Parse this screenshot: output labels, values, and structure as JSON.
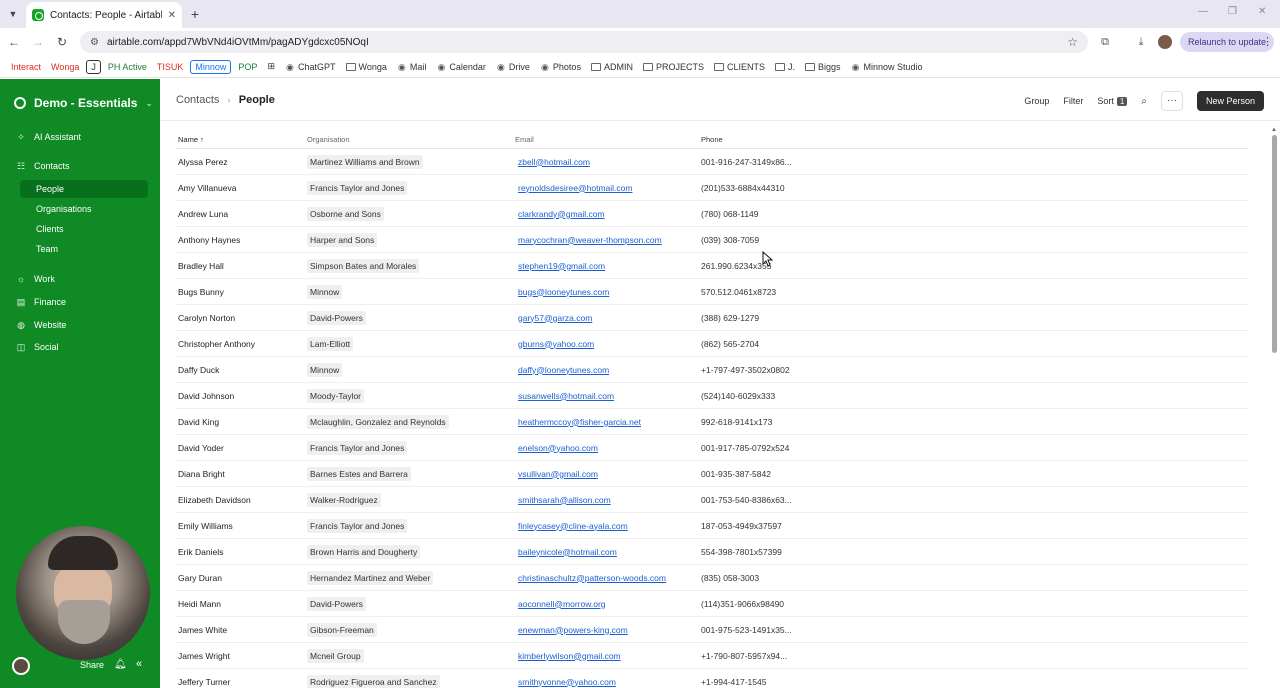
{
  "browser": {
    "tab_title": "Contacts: People - Airtable",
    "url": "airtable.com/appd7WbVNd4iOVtMm/pagADYgdcxc05NOqI",
    "relaunch_label": "Relaunch to update"
  },
  "bookmarks": [
    {
      "label": "Interact",
      "color": "#d93025",
      "style": "text"
    },
    {
      "label": "Wonga",
      "color": "#d93025",
      "style": "text"
    },
    {
      "label": "J",
      "color": "#333333",
      "style": "box"
    },
    {
      "label": "PH Active",
      "color": "#1e7e34",
      "style": "text"
    },
    {
      "label": "TISUK",
      "color": "#d93025",
      "style": "text"
    },
    {
      "label": "Minnow",
      "color": "#1a73e8",
      "style": "box"
    },
    {
      "label": "POP",
      "color": "#188038",
      "style": "text"
    },
    {
      "label": "ChatGPT",
      "color": "#333333",
      "style": "icon"
    },
    {
      "label": "Wonga",
      "color": "#333333",
      "style": "folder"
    },
    {
      "label": "Mail",
      "color": "#333333",
      "style": "icon"
    },
    {
      "label": "Calendar",
      "color": "#333333",
      "style": "icon"
    },
    {
      "label": "Drive",
      "color": "#333333",
      "style": "icon"
    },
    {
      "label": "Photos",
      "color": "#333333",
      "style": "icon"
    },
    {
      "label": "ADMIN",
      "color": "#333333",
      "style": "folder"
    },
    {
      "label": "PROJECTS",
      "color": "#333333",
      "style": "folder"
    },
    {
      "label": "CLIENTS",
      "color": "#333333",
      "style": "folder"
    },
    {
      "label": "J.",
      "color": "#333333",
      "style": "folder"
    },
    {
      "label": "Biggs",
      "color": "#333333",
      "style": "folder"
    },
    {
      "label": "Minnow Studio",
      "color": "#333333",
      "style": "icon"
    }
  ],
  "sidebar": {
    "workspace": "Demo - Essentials",
    "ai_assistant": "AI Assistant",
    "contacts": "Contacts",
    "contacts_sub": [
      "People",
      "Organisations",
      "Clients",
      "Team"
    ],
    "work": "Work",
    "finance": "Finance",
    "website": "Website",
    "social": "Social",
    "share": "Share"
  },
  "main": {
    "breadcrumb_parent": "Contacts",
    "breadcrumb_current": "People",
    "group": "Group",
    "filter": "Filter",
    "sort": "Sort",
    "sort_count": "1",
    "new_button": "New Person"
  },
  "table": {
    "headers": {
      "name": "Name",
      "organisation": "Organisation",
      "email": "Email",
      "phone": "Phone"
    },
    "rows": [
      {
        "name": "Alyssa Perez",
        "org": "Martinez Williams and Brown",
        "email": "zbell@hotmail.com",
        "phone": "001-916-247-3149x86..."
      },
      {
        "name": "Amy Villanueva",
        "org": "Francis Taylor and Jones",
        "email": "reynoldsdesiree@hotmail.com",
        "phone": "(201)533-6884x44310"
      },
      {
        "name": "Andrew Luna",
        "org": "Osborne and Sons",
        "email": "clarkrandy@gmail.com",
        "phone": "(780) 068-1149"
      },
      {
        "name": "Anthony Haynes",
        "org": "Harper and Sons",
        "email": "marycochran@weaver-thompson.com",
        "phone": "(039) 308-7059"
      },
      {
        "name": "Bradley Hall",
        "org": "Simpson Bates and Morales",
        "email": "stephen19@gmail.com",
        "phone": "261.990.6234x355"
      },
      {
        "name": "Bugs Bunny",
        "org": "Minnow",
        "email": "bugs@looneytunes.com",
        "phone": "570.512.0461x8723"
      },
      {
        "name": "Carolyn Norton",
        "org": "David-Powers",
        "email": "gary57@garza.com",
        "phone": "(388) 629-1279"
      },
      {
        "name": "Christopher Anthony",
        "org": "Lam-Elliott",
        "email": "gburns@yahoo.com",
        "phone": "(862) 565-2704"
      },
      {
        "name": "Daffy Duck",
        "org": "Minnow",
        "email": "daffy@looneytunes.com",
        "phone": "+1-797-497-3502x0802"
      },
      {
        "name": "David Johnson",
        "org": "Moody-Taylor",
        "email": "susanwells@hotmail.com",
        "phone": "(524)140-6029x333"
      },
      {
        "name": "David King",
        "org": "Mclaughlin, Gonzalez and Reynolds",
        "email": "heathermccoy@fisher-garcia.net",
        "phone": "992-618-9141x173"
      },
      {
        "name": "David Yoder",
        "org": "Francis Taylor and Jones",
        "email": "enelson@yahoo.com",
        "phone": "001-917-785-0792x524"
      },
      {
        "name": "Diana Bright",
        "org": "Barnes Estes and Barrera",
        "email": "vsullivan@gmail.com",
        "phone": "001-935-387-5842"
      },
      {
        "name": "Elizabeth Davidson",
        "org": "Walker-Rodriguez",
        "email": "smithsarah@allison.com",
        "phone": "001-753-540-8386x63..."
      },
      {
        "name": "Emily Williams",
        "org": "Francis Taylor and Jones",
        "email": "finleycasey@cline-ayala.com",
        "phone": "187-053-4949x37597"
      },
      {
        "name": "Erik Daniels",
        "org": "Brown Harris and Dougherty",
        "email": "baileynicole@hotmail.com",
        "phone": "554-398-7801x57399"
      },
      {
        "name": "Gary Duran",
        "org": "Hernandez Martinez and Weber",
        "email": "christinaschultz@patterson-woods.com",
        "phone": "(835) 058-3003"
      },
      {
        "name": "Heidi Mann",
        "org": "David-Powers",
        "email": "aoconnell@morrow.org",
        "phone": "(114)351-9066x98490"
      },
      {
        "name": "James White",
        "org": "Gibson-Freeman",
        "email": "enewman@powers-king.com",
        "phone": "001-975-523-1491x35..."
      },
      {
        "name": "James Wright",
        "org": "Mcneil Group",
        "email": "kimberlywilson@gmail.com",
        "phone": "+1-790-807-5957x94..."
      },
      {
        "name": "Jeffery Turner",
        "org": "Rodriguez Figueroa and Sanchez",
        "email": "smithyvonne@yahoo.com",
        "phone": "+1-994-417-1545"
      }
    ]
  }
}
